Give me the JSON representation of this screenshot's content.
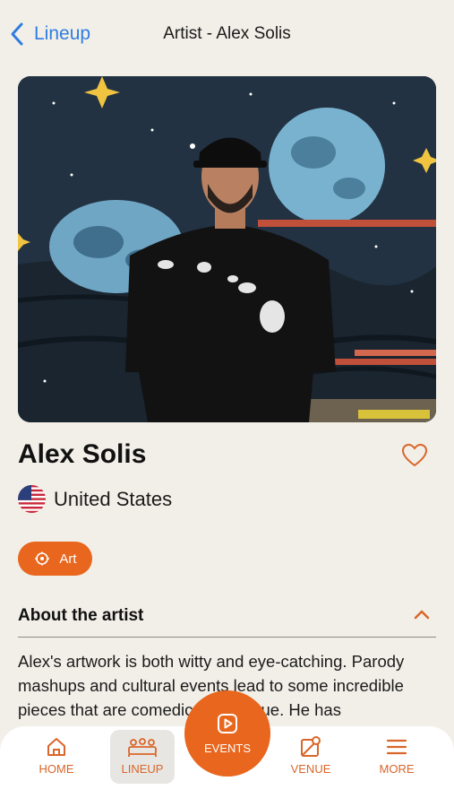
{
  "header": {
    "back_label": "Lineup",
    "title": "Artist - Alex Solis"
  },
  "artist": {
    "name": "Alex Solis",
    "country": "United States",
    "category": "Art",
    "favorited": false
  },
  "about": {
    "title": "About the artist",
    "expanded": true,
    "text": "Alex's artwork is both witty and eye-catching. Parody mashups and cultural events lead to some incredible pieces that are comedic and unique. He has"
  },
  "tabbar": {
    "home": "HOME",
    "lineup": "LINEUP",
    "events": "EVENTS",
    "venue": "VENUE",
    "more": "MORE",
    "active": "lineup"
  },
  "colors": {
    "accent": "#e8661d",
    "link": "#2f7de1",
    "background": "#f2efe8"
  },
  "icons": [
    "chevron-left-icon",
    "heart-icon",
    "us-flag-icon",
    "art-icon",
    "chevron-up-icon",
    "home-icon",
    "lineup-icon",
    "events-play-icon",
    "venue-map-icon",
    "menu-icon"
  ]
}
